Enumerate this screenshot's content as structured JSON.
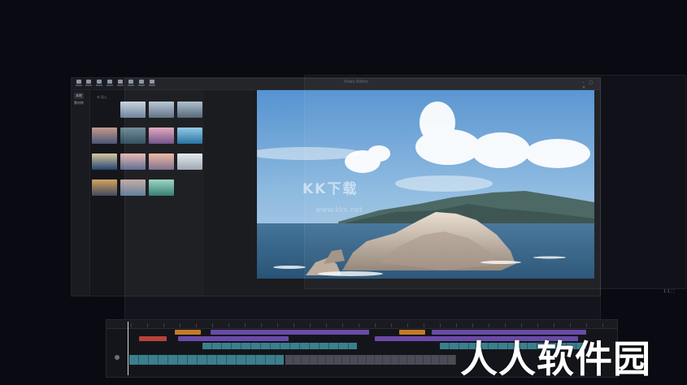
{
  "window": {
    "title": "Video Editor",
    "controls": "– □ ×"
  },
  "toolbar": {
    "tools": [
      "media-icon",
      "audio-icon",
      "text-icon",
      "sticker-icon",
      "effects-icon",
      "transition-icon",
      "filter-icon",
      "adjust-icon"
    ]
  },
  "sidebar": {
    "items": [
      {
        "label": "本地"
      },
      {
        "label": "素材库"
      }
    ]
  },
  "media": {
    "sort_label": "☰ 导入",
    "thumbnails": [
      {
        "colors": [
          "#6b7f99",
          "#c9d2de"
        ]
      },
      {
        "colors": [
          "#5b6e82",
          "#b8c6d3"
        ]
      },
      {
        "colors": [
          "#4d6274",
          "#aebecb"
        ]
      },
      {
        "colors": [
          "#4a5578",
          "#c69a8c"
        ]
      },
      {
        "colors": [
          "#2d4a5c",
          "#6d8a96"
        ]
      },
      {
        "colors": [
          "#6c4f86",
          "#e1a7bd"
        ]
      },
      {
        "colors": [
          "#1f6e9e",
          "#8fc9e6"
        ]
      },
      {
        "colors": [
          "#23456e",
          "#d7c6a0"
        ]
      },
      {
        "colors": [
          "#5a6790",
          "#e7b8b1"
        ]
      },
      {
        "colors": [
          "#7a6c8c",
          "#f2b7a0"
        ]
      },
      {
        "colors": [
          "#9aa5b0",
          "#e4e9ee"
        ]
      },
      {
        "colors": [
          "#3e4a5e",
          "#d6a35f"
        ]
      },
      {
        "colors": [
          "#5c7b99",
          "#c3a9a0"
        ]
      },
      {
        "colors": [
          "#2e7b6e",
          "#9ad4c3"
        ]
      }
    ]
  },
  "preview": {
    "status": "1:1  ⛶"
  },
  "timeline": {
    "clips_row1": [
      {
        "color": "#c47a2a"
      },
      {
        "color": "#6a4aa8"
      },
      {
        "color": "#c47a2a"
      },
      {
        "color": "#6a4aa8"
      }
    ],
    "clips_row2": [
      {
        "color": "#b8423a"
      },
      {
        "color": "#6a4aa8"
      },
      {
        "color": "#6a4aa8"
      }
    ]
  },
  "watermarks": {
    "site_logo": "KK下载",
    "site_url": "www.kkx.net",
    "corner_text": "人人软件园"
  }
}
